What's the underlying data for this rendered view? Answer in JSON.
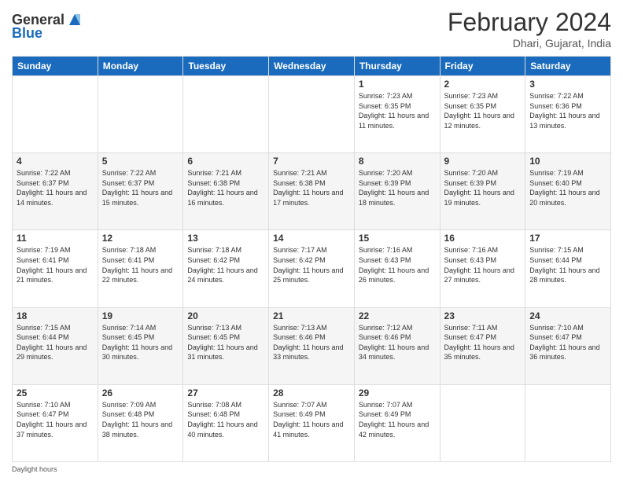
{
  "header": {
    "logo_general": "General",
    "logo_blue": "Blue",
    "month_year": "February 2024",
    "location": "Dhari, Gujarat, India"
  },
  "days_of_week": [
    "Sunday",
    "Monday",
    "Tuesday",
    "Wednesday",
    "Thursday",
    "Friday",
    "Saturday"
  ],
  "weeks": [
    [
      {
        "day": "",
        "sunrise": "",
        "sunset": "",
        "daylight": ""
      },
      {
        "day": "",
        "sunrise": "",
        "sunset": "",
        "daylight": ""
      },
      {
        "day": "",
        "sunrise": "",
        "sunset": "",
        "daylight": ""
      },
      {
        "day": "",
        "sunrise": "",
        "sunset": "",
        "daylight": ""
      },
      {
        "day": "1",
        "sunrise": "Sunrise: 7:23 AM",
        "sunset": "Sunset: 6:35 PM",
        "daylight": "Daylight: 11 hours and 11 minutes."
      },
      {
        "day": "2",
        "sunrise": "Sunrise: 7:23 AM",
        "sunset": "Sunset: 6:35 PM",
        "daylight": "Daylight: 11 hours and 12 minutes."
      },
      {
        "day": "3",
        "sunrise": "Sunrise: 7:22 AM",
        "sunset": "Sunset: 6:36 PM",
        "daylight": "Daylight: 11 hours and 13 minutes."
      }
    ],
    [
      {
        "day": "4",
        "sunrise": "Sunrise: 7:22 AM",
        "sunset": "Sunset: 6:37 PM",
        "daylight": "Daylight: 11 hours and 14 minutes."
      },
      {
        "day": "5",
        "sunrise": "Sunrise: 7:22 AM",
        "sunset": "Sunset: 6:37 PM",
        "daylight": "Daylight: 11 hours and 15 minutes."
      },
      {
        "day": "6",
        "sunrise": "Sunrise: 7:21 AM",
        "sunset": "Sunset: 6:38 PM",
        "daylight": "Daylight: 11 hours and 16 minutes."
      },
      {
        "day": "7",
        "sunrise": "Sunrise: 7:21 AM",
        "sunset": "Sunset: 6:38 PM",
        "daylight": "Daylight: 11 hours and 17 minutes."
      },
      {
        "day": "8",
        "sunrise": "Sunrise: 7:20 AM",
        "sunset": "Sunset: 6:39 PM",
        "daylight": "Daylight: 11 hours and 18 minutes."
      },
      {
        "day": "9",
        "sunrise": "Sunrise: 7:20 AM",
        "sunset": "Sunset: 6:39 PM",
        "daylight": "Daylight: 11 hours and 19 minutes."
      },
      {
        "day": "10",
        "sunrise": "Sunrise: 7:19 AM",
        "sunset": "Sunset: 6:40 PM",
        "daylight": "Daylight: 11 hours and 20 minutes."
      }
    ],
    [
      {
        "day": "11",
        "sunrise": "Sunrise: 7:19 AM",
        "sunset": "Sunset: 6:41 PM",
        "daylight": "Daylight: 11 hours and 21 minutes."
      },
      {
        "day": "12",
        "sunrise": "Sunrise: 7:18 AM",
        "sunset": "Sunset: 6:41 PM",
        "daylight": "Daylight: 11 hours and 22 minutes."
      },
      {
        "day": "13",
        "sunrise": "Sunrise: 7:18 AM",
        "sunset": "Sunset: 6:42 PM",
        "daylight": "Daylight: 11 hours and 24 minutes."
      },
      {
        "day": "14",
        "sunrise": "Sunrise: 7:17 AM",
        "sunset": "Sunset: 6:42 PM",
        "daylight": "Daylight: 11 hours and 25 minutes."
      },
      {
        "day": "15",
        "sunrise": "Sunrise: 7:16 AM",
        "sunset": "Sunset: 6:43 PM",
        "daylight": "Daylight: 11 hours and 26 minutes."
      },
      {
        "day": "16",
        "sunrise": "Sunrise: 7:16 AM",
        "sunset": "Sunset: 6:43 PM",
        "daylight": "Daylight: 11 hours and 27 minutes."
      },
      {
        "day": "17",
        "sunrise": "Sunrise: 7:15 AM",
        "sunset": "Sunset: 6:44 PM",
        "daylight": "Daylight: 11 hours and 28 minutes."
      }
    ],
    [
      {
        "day": "18",
        "sunrise": "Sunrise: 7:15 AM",
        "sunset": "Sunset: 6:44 PM",
        "daylight": "Daylight: 11 hours and 29 minutes."
      },
      {
        "day": "19",
        "sunrise": "Sunrise: 7:14 AM",
        "sunset": "Sunset: 6:45 PM",
        "daylight": "Daylight: 11 hours and 30 minutes."
      },
      {
        "day": "20",
        "sunrise": "Sunrise: 7:13 AM",
        "sunset": "Sunset: 6:45 PM",
        "daylight": "Daylight: 11 hours and 31 minutes."
      },
      {
        "day": "21",
        "sunrise": "Sunrise: 7:13 AM",
        "sunset": "Sunset: 6:46 PM",
        "daylight": "Daylight: 11 hours and 33 minutes."
      },
      {
        "day": "22",
        "sunrise": "Sunrise: 7:12 AM",
        "sunset": "Sunset: 6:46 PM",
        "daylight": "Daylight: 11 hours and 34 minutes."
      },
      {
        "day": "23",
        "sunrise": "Sunrise: 7:11 AM",
        "sunset": "Sunset: 6:47 PM",
        "daylight": "Daylight: 11 hours and 35 minutes."
      },
      {
        "day": "24",
        "sunrise": "Sunrise: 7:10 AM",
        "sunset": "Sunset: 6:47 PM",
        "daylight": "Daylight: 11 hours and 36 minutes."
      }
    ],
    [
      {
        "day": "25",
        "sunrise": "Sunrise: 7:10 AM",
        "sunset": "Sunset: 6:47 PM",
        "daylight": "Daylight: 11 hours and 37 minutes."
      },
      {
        "day": "26",
        "sunrise": "Sunrise: 7:09 AM",
        "sunset": "Sunset: 6:48 PM",
        "daylight": "Daylight: 11 hours and 38 minutes."
      },
      {
        "day": "27",
        "sunrise": "Sunrise: 7:08 AM",
        "sunset": "Sunset: 6:48 PM",
        "daylight": "Daylight: 11 hours and 40 minutes."
      },
      {
        "day": "28",
        "sunrise": "Sunrise: 7:07 AM",
        "sunset": "Sunset: 6:49 PM",
        "daylight": "Daylight: 11 hours and 41 minutes."
      },
      {
        "day": "29",
        "sunrise": "Sunrise: 7:07 AM",
        "sunset": "Sunset: 6:49 PM",
        "daylight": "Daylight: 11 hours and 42 minutes."
      },
      {
        "day": "",
        "sunrise": "",
        "sunset": "",
        "daylight": ""
      },
      {
        "day": "",
        "sunrise": "",
        "sunset": "",
        "daylight": ""
      }
    ]
  ],
  "footer": {
    "daylight_label": "Daylight hours"
  }
}
